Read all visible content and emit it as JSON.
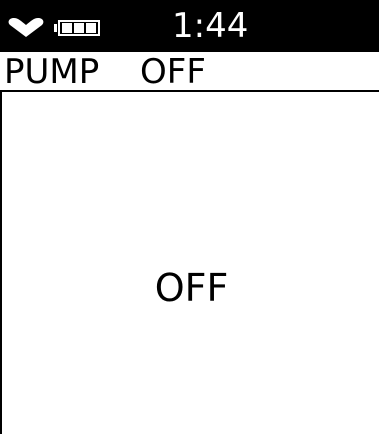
{
  "status_bar": {
    "heart_icon": "heart-icon",
    "battery_icon": "battery-icon",
    "time": "1:44",
    "background": "#000000",
    "foreground": "#ffffff"
  },
  "header": {
    "label": "PUMP",
    "value": "OFF"
  },
  "main": {
    "state": "OFF"
  }
}
